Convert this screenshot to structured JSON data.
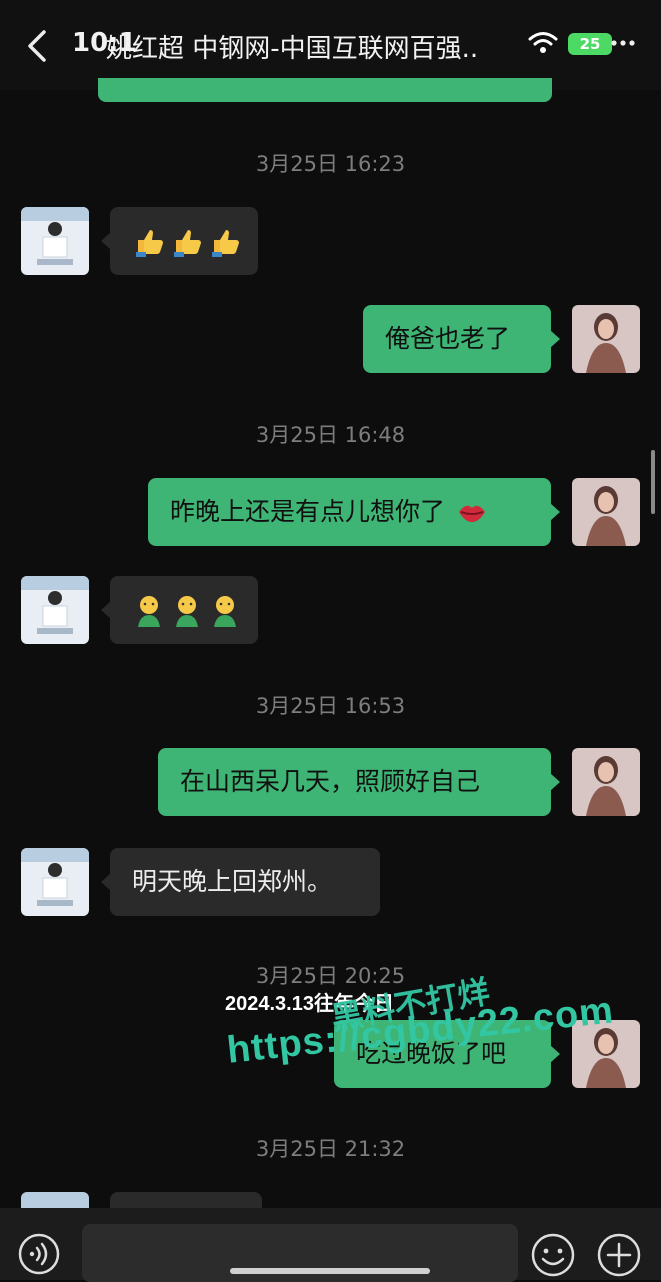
{
  "status_bar": {
    "time": "10:1",
    "battery": "25"
  },
  "header": {
    "back_icon": "chevron-left-icon",
    "title": "姚红超 中钢网-中国互联网百强..",
    "wifi_icon": "wifi-icon",
    "more_icon": "more-dots-icon"
  },
  "messages": [
    {
      "type": "timestamp",
      "text": "3月25日 16:23"
    },
    {
      "type": "received",
      "kind": "emoji",
      "emoji": "thumbs-up-icon",
      "count": 3
    },
    {
      "type": "sent",
      "text": "俺爸也老了"
    },
    {
      "type": "timestamp",
      "text": "3月25日 16:48"
    },
    {
      "type": "sent",
      "text": "昨晚上还是有点儿想你了",
      "trailing_emoji": "kiss-lips-icon"
    },
    {
      "type": "received",
      "kind": "emoji",
      "emoji": "shy-face-icon",
      "count": 3
    },
    {
      "type": "timestamp",
      "text": "3月25日 16:53"
    },
    {
      "type": "sent",
      "text": "在山西呆几天，照顾好自己"
    },
    {
      "type": "received",
      "text": "明天晚上回郑州。"
    },
    {
      "type": "timestamp",
      "text": "3月25日 20:25"
    },
    {
      "type": "sent",
      "text": "吃过晚饭了吧"
    },
    {
      "type": "timestamp",
      "text": "3月25日 21:32"
    }
  ],
  "overlay": {
    "date_caption": "2024.3.13往年今日",
    "tag_text": "黑料不打烊",
    "url_text": "https://cgbdy22.com"
  },
  "input_bar": {
    "voice_icon": "voice-icon",
    "emoji_icon": "smiley-icon",
    "plus_icon": "plus-icon",
    "placeholder": ""
  },
  "colors": {
    "sent_bubble": "#3eb575",
    "received_bubble": "#2a2a2a",
    "background": "#0d0d0d",
    "watermark": "#33c6a3"
  }
}
